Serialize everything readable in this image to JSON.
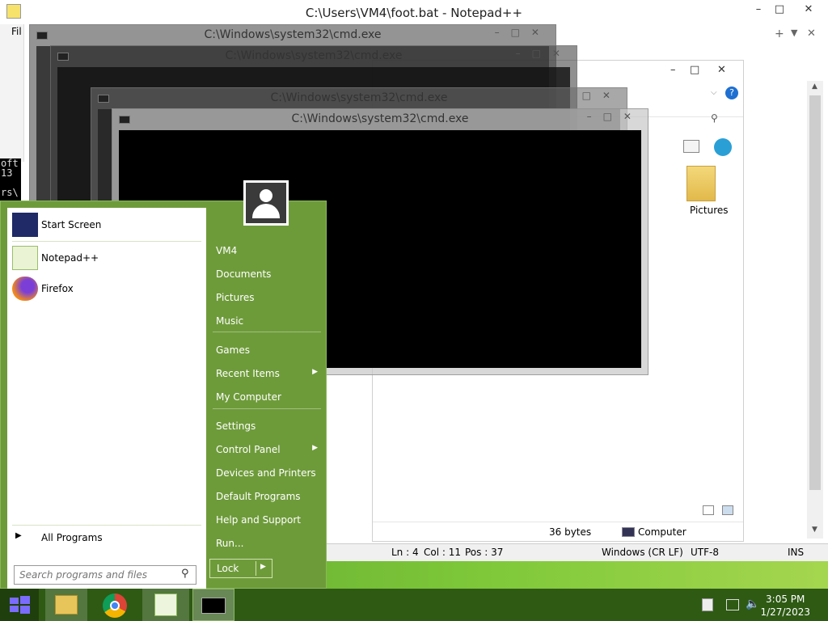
{
  "notepad": {
    "title": "C:\\Users\\VM4\\foot.bat - Notepad++",
    "menu_fragment": "Fil",
    "status": {
      "ln": "Ln : 4",
      "col": "Col : 11",
      "pos": "Pos : 37",
      "eol": "Windows (CR LF)",
      "encoding": "UTF-8",
      "mode": "INS"
    },
    "left_text": [
      "oft",
      "13",
      "rs\\"
    ]
  },
  "explorer": {
    "item_label": "Pictures",
    "status_size": "36 bytes",
    "status_location": "Computer"
  },
  "cmd_windows": [
    {
      "title": "C:\\Windows\\system32\\cmd.exe"
    },
    {
      "title": "C:\\Windows\\system32\\cmd.exe"
    },
    {
      "title": "C:\\Windows\\system32\\cmd.exe"
    },
    {
      "title": "C:\\Windows\\system32\\cmd.exe"
    }
  ],
  "start_menu": {
    "pinned": [
      {
        "label": "Start Screen",
        "icon": "start-screen-icon"
      },
      {
        "label": "Notepad++",
        "icon": "notepadpp-icon"
      },
      {
        "label": "Firefox",
        "icon": "firefox-icon"
      }
    ],
    "all_programs": "All Programs",
    "search_placeholder": "Search programs and files",
    "right_items": [
      {
        "label": "VM4"
      },
      {
        "label": "Documents"
      },
      {
        "label": "Pictures"
      },
      {
        "label": "Music"
      },
      {
        "label": "Games"
      },
      {
        "label": "Recent Items",
        "submenu": true
      },
      {
        "label": "My Computer"
      },
      {
        "label": "Settings"
      },
      {
        "label": "Control Panel",
        "submenu": true
      },
      {
        "label": "Devices and Printers"
      },
      {
        "label": "Default Programs"
      },
      {
        "label": "Help and Support"
      },
      {
        "label": "Run..."
      }
    ],
    "lock_label": "Lock"
  },
  "taskbar": {
    "time": "3:05 PM",
    "date": "1/27/2023",
    "apps": [
      "file-explorer-icon",
      "chrome-icon",
      "notepadpp-icon",
      "cmd-icon"
    ]
  },
  "colors": {
    "start_green": "#6e9b3a",
    "taskbar": "#2e5a14"
  }
}
